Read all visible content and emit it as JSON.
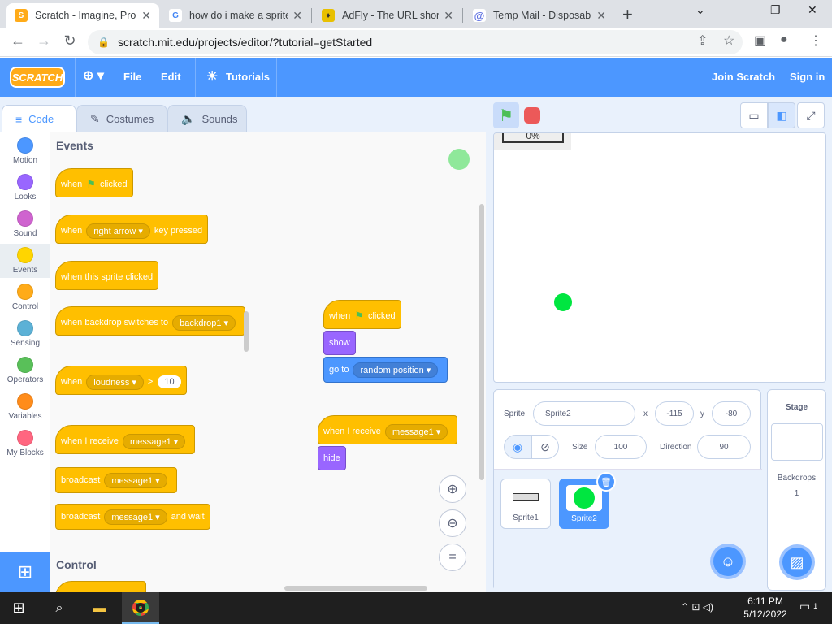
{
  "browser": {
    "tabs": [
      {
        "title": "Scratch - Imagine, Prog",
        "active": true
      },
      {
        "title": "how do i make a sprite",
        "active": false
      },
      {
        "title": "AdFly - The URL shorte",
        "active": false
      },
      {
        "title": "Temp Mail - Disposable",
        "active": false
      }
    ],
    "url": "scratch.mit.edu/projects/editor/?tutorial=getStarted"
  },
  "menubar": {
    "logo": "SCRATCH",
    "file": "File",
    "edit": "Edit",
    "tutorials": "Tutorials",
    "join": "Join Scratch",
    "signin": "Sign in"
  },
  "editor_tabs": [
    "Code",
    "Costumes",
    "Sounds"
  ],
  "categories": [
    {
      "label": "Motion",
      "color": "#4c97ff"
    },
    {
      "label": "Looks",
      "color": "#9966ff"
    },
    {
      "label": "Sound",
      "color": "#cf63cf"
    },
    {
      "label": "Events",
      "color": "#ffd500"
    },
    {
      "label": "Control",
      "color": "#ffab19"
    },
    {
      "label": "Sensing",
      "color": "#5cb1d6"
    },
    {
      "label": "Operators",
      "color": "#59c059"
    },
    {
      "label": "Variables",
      "color": "#ff8c1a"
    },
    {
      "label": "My Blocks",
      "color": "#ff6680"
    }
  ],
  "palette": {
    "events_heading": "Events",
    "control_heading": "Control",
    "b1": {
      "when": "when",
      "clicked": "clicked"
    },
    "b2": {
      "when": "when",
      "key": "right arrow",
      "pressed": "key pressed"
    },
    "b3": {
      "text": "when this sprite clicked"
    },
    "b4": {
      "text": "when backdrop switches to",
      "backdrop": "backdrop1"
    },
    "b5": {
      "when": "when",
      "param": "loudness",
      "gt": ">",
      "value": "10"
    },
    "b6": {
      "text": "when I receive",
      "message": "message1"
    },
    "b7": {
      "text": "broadcast",
      "message": "message1"
    },
    "b8": {
      "text": "broadcast",
      "message": "message1",
      "suffix": "and wait"
    }
  },
  "scripts": {
    "s1_when": "when",
    "s1_clicked": "clicked",
    "s1_show": "show",
    "s1_goto": "go to",
    "s1_target": "random position",
    "s2_receive": "when I receive",
    "s2_message": "message1",
    "s2_hide": "hide"
  },
  "stage": {
    "monitor_text": "0%"
  },
  "sprite_info": {
    "sprite_label": "Sprite",
    "sprite_name": "Sprite2",
    "x_label": "x",
    "x_value": "-115",
    "y_label": "y",
    "y_value": "-80",
    "size_label": "Size",
    "size_value": "100",
    "direction_label": "Direction",
    "direction_value": "90"
  },
  "sprites": [
    {
      "name": "Sprite1",
      "selected": false
    },
    {
      "name": "Sprite2",
      "selected": true
    }
  ],
  "stage_panel": {
    "title": "Stage",
    "backdrops_label": "Backdrops",
    "backdrops_count": "1"
  },
  "taskbar": {
    "time": "6:11 PM",
    "date": "5/12/2022",
    "notifications": "1"
  }
}
